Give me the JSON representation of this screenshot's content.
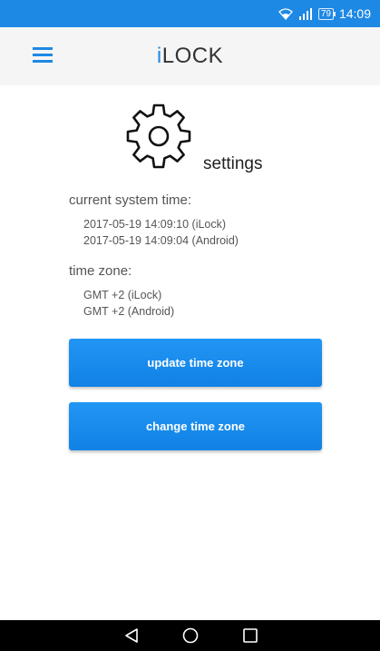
{
  "status_bar": {
    "battery": "79",
    "time": "14:09",
    "icons": [
      "wifi-icon",
      "signal-icon",
      "battery-icon"
    ]
  },
  "app_bar": {
    "title_prefix": "i",
    "title_rest": "LOCK",
    "menu_icon": "hamburger-menu-icon"
  },
  "header": {
    "icon": "gear-icon",
    "label": "settings"
  },
  "system_time": {
    "heading": "current system time:",
    "ilock": "2017-05-19 14:09:10 (iLock)",
    "android": "2017-05-19 14:09:04 (Android)"
  },
  "time_zone": {
    "heading": "time zone:",
    "ilock": "GMT +2 (iLock)",
    "android": "GMT +2 (Android)"
  },
  "buttons": {
    "update": "update time zone",
    "change": "change time zone"
  },
  "nav_bar": {
    "icons": [
      "back-icon",
      "home-icon",
      "recents-icon"
    ]
  },
  "colors": {
    "accent": "#1e88e5",
    "button": "#2196f3",
    "app_bar_bg": "#f5f5f5"
  }
}
